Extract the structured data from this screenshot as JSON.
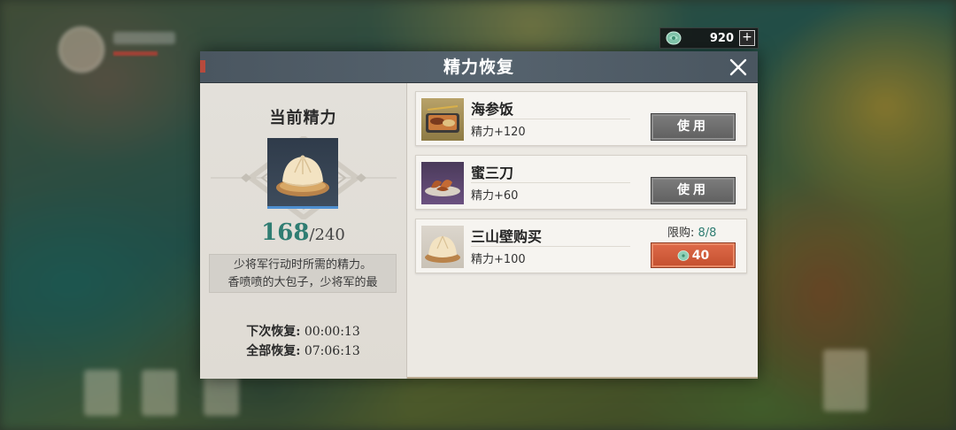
{
  "currency": {
    "icon": "jade-coin-icon",
    "amount": "920",
    "plus_label": "+"
  },
  "dialog": {
    "title": "精力恢复",
    "left": {
      "heading": "当前精力",
      "item_icon": "steamed-bun-icon",
      "energy_current": "168",
      "energy_max": "/240",
      "desc_line1": "少将军行动时所需的精力。",
      "desc_line2": "香喷喷的大包子，少将军的最",
      "next_label": "下次恢复:",
      "next_time": "00:00:13",
      "full_label": "全部恢复:",
      "full_time": "07:06:13"
    },
    "items": [
      {
        "name": "海参饭",
        "effect": "精力+120",
        "icon": "seafood-rice-icon",
        "button": "使用"
      },
      {
        "name": "蜜三刀",
        "effect": "精力+60",
        "icon": "honey-pastry-icon",
        "button": "使用"
      },
      {
        "name": "三山壁购买",
        "effect": "精力+100",
        "icon": "steamed-bun-icon",
        "limit_label": "限购:",
        "limit_value": "8/8",
        "price": "40"
      }
    ]
  },
  "colors": {
    "accent_teal": "#2f7d72",
    "buy_red": "#d35d3c",
    "header": "#4f5b66"
  }
}
